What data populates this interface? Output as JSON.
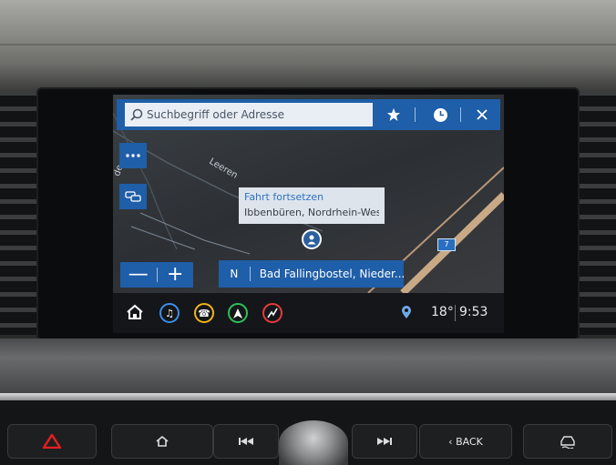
{
  "search": {
    "placeholder": "Suchbegriff oder Adresse"
  },
  "popup": {
    "title": "Fahrt fortsetzen",
    "address": "Ibbenbüren, Nordrhein-Wes..."
  },
  "map": {
    "street_label": "Leeren",
    "street_label_2": "de",
    "route_badge": "7"
  },
  "destination": {
    "direction": "N",
    "name": "Bad Fallingbostel, Nieder..."
  },
  "zoom": {
    "minus": "—",
    "plus": "+"
  },
  "status": {
    "temperature": "18°",
    "time": "9:53"
  },
  "console": {
    "back_label": "BACK"
  },
  "icons": {
    "search": "search-icon",
    "favorite": "star-icon",
    "recent": "clock-icon",
    "close": "close-icon",
    "more": "more-dots-icon",
    "traffic": "traffic-cars-icon",
    "home": "home-icon",
    "music": "music-icon",
    "phone": "phone-icon",
    "nav": "navigation-icon",
    "route": "route-icon",
    "location": "location-pin-icon"
  },
  "colors": {
    "accent": "#1f5ea8",
    "music": "#3d8ee8",
    "phone": "#f0b418",
    "nav": "#2fbf5a",
    "route": "#e83a3a",
    "hazard": "#e02020"
  }
}
